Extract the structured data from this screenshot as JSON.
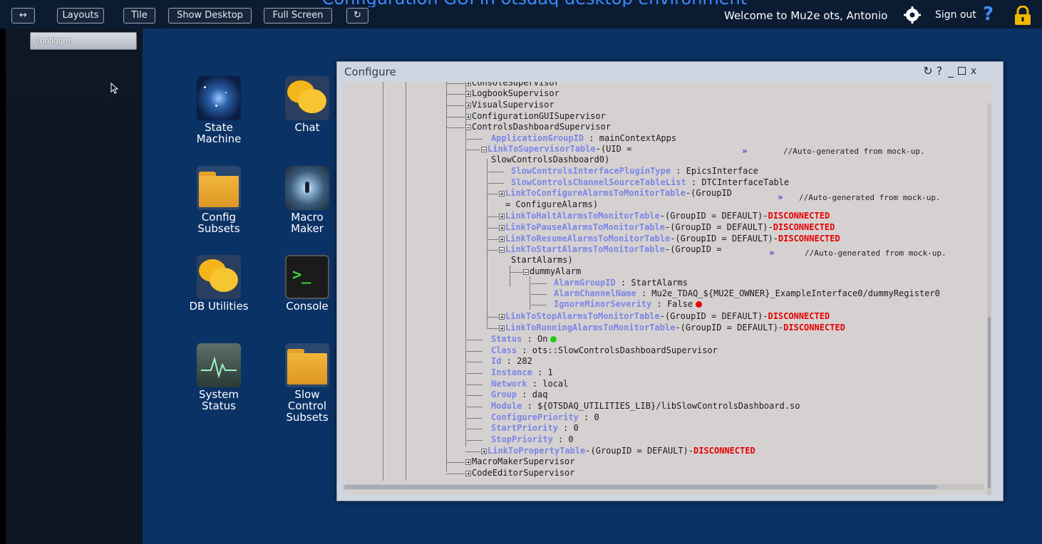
{
  "overlay_caption": "Configuration GUI in otsdaq desktop environment",
  "topbar": {
    "buttons": [
      "Layouts",
      "Tile",
      "Show Desktop",
      "Full Screen"
    ],
    "welcome": "Welcome to Mu2e ots, Antonio",
    "sign_out": "Sign out"
  },
  "sidebar": {
    "active_window": "Configure"
  },
  "desktop_icons": [
    {
      "label": "State\nMachine",
      "icon": "state-machine-icon"
    },
    {
      "label": "Chat",
      "icon": "chat-icon"
    },
    {
      "label": "Config\nSubsets",
      "icon": "folder-icon"
    },
    {
      "label": "Macro\nMaker",
      "icon": "macro-maker-icon"
    },
    {
      "label": "DB Utilities",
      "icon": "chat-icon"
    },
    {
      "label": "Console",
      "icon": "console-icon"
    },
    {
      "label": "System\nStatus",
      "icon": "system-status-icon"
    },
    {
      "label": "Slow\nControl\nSubsets",
      "icon": "folder-icon"
    }
  ],
  "window": {
    "title": "Configure",
    "tree": {
      "console_supervisor": "ConsoleSupervisor",
      "logbook_supervisor": "LogbookSupervisor",
      "visual_supervisor": "VisualSupervisor",
      "config_gui_supervisor": "ConfigurationGUISupervisor",
      "controls_dashboard": "ControlsDashboardSupervisor",
      "app_group_key": "ApplicationGroupID",
      "app_group_val": " : mainContextApps",
      "link_sup_key": "LinkToSupervisorTable",
      "link_sup_val": "-(UID =",
      "link_sup_val2": "SlowControlsDashboard0)",
      "comment": "//Auto-generated from mock-up.",
      "arrow": "»",
      "plugin_key": "SlowControlsInterfacePluginType",
      "plugin_val": " : EpicsInterface",
      "chan_key": "SlowControlsChannelSourceTableList",
      "chan_val": " : DTCInterfaceTable",
      "cfg_alarms_key": "LinkToConfigureAlarmsToMonitorTable",
      "cfg_alarms_val": "-(GroupID",
      "cfg_alarms_val2": "= ConfigureAlarms)",
      "halt_key": "LinkToHaltAlarmsToMonitorTable",
      "pause_key": "LinkToPauseAlarmsToMonitorTable",
      "resume_key": "LinkToResumeAlarmsToMonitorTable",
      "group_default": "-(GroupID = DEFAULT)-",
      "disconnected": "DISCONNECTED",
      "start_key": "LinkToStartAlarmsToMonitorTable",
      "start_val": "-(GroupID =",
      "start_val2": "StartAlarms)",
      "dummy_alarm": "dummyAlarm",
      "alarm_group_key": "AlarmGroupID",
      "alarm_group_val": " : StartAlarms",
      "alarm_chan_key": "AlarmChannelName",
      "alarm_chan_val": " : Mu2e_TDAQ_${MU2E_OWNER}_ExampleInterface0/dummyRegister0",
      "ignore_key": "IgnoreMinorSeverity",
      "ignore_val": " : False",
      "stop_key": "LinkToStopAlarmsToMonitorTable",
      "running_key": "LinkToRunningAlarmsToMonitorTable",
      "status_key": "Status",
      "status_val": " : On",
      "class_key": "Class",
      "class_val": " : ots::SlowControlsDashboardSupervisor",
      "id_key": "Id",
      "id_val": " : 282",
      "instance_key": "Instance",
      "instance_val": " : 1",
      "network_key": "Network",
      "network_val": " : local",
      "group_key": "Group",
      "group_val": " : daq",
      "module_key": "Module",
      "module_val": " : ${OTSDAQ_UTILITIES_LIB}/libSlowControlsDashboard.so",
      "cfg_prio_key": "ConfigurePriority",
      "cfg_prio_val": " : 0",
      "start_prio_key": "StartPriority",
      "start_prio_val": " : 0",
      "stop_prio_key": "StopPriority",
      "stop_prio_val": " : 0",
      "property_key": "LinkToPropertyTable",
      "macro_maker_sup": "MacroMakerSupervisor",
      "code_editor_sup": "CodeEditorSupervisor"
    }
  },
  "colors": {
    "key": "#7a86e6",
    "disconnected": "#e60000",
    "status_on": "#22cc22",
    "status_false": "#ee0000",
    "accent": "#f0b800"
  }
}
